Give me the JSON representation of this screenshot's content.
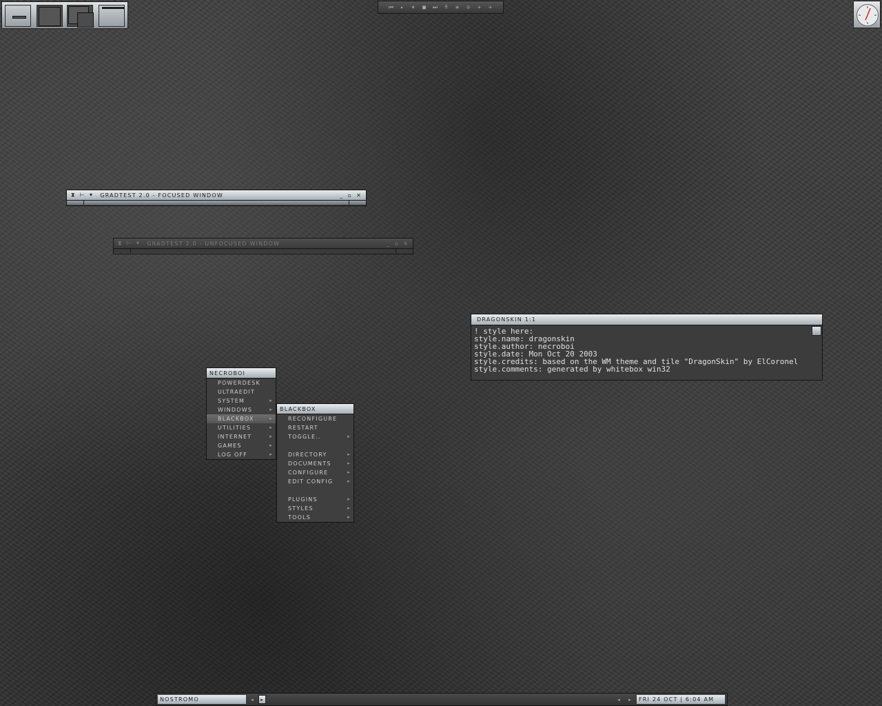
{
  "media_controls": [
    "⏮",
    "▸",
    "⏸",
    "■",
    "⏭",
    "≚",
    "≡",
    "⊙",
    "+",
    "+"
  ],
  "focused_window": {
    "buttons": [
      "⧗",
      "⊢",
      "▾"
    ],
    "title": "GRADTEST 2.0 - FOCUSED WINDOW",
    "controls": [
      "_",
      "▫",
      "✕"
    ]
  },
  "unfocused_window": {
    "buttons": [
      "⧗",
      "⊢",
      "▾"
    ],
    "title": "GRADTEST 2.0 - UNFOCUSED WINDOW",
    "controls": [
      "_",
      "▫",
      "✕"
    ]
  },
  "viewer": {
    "title": "DRAGONSKIN  1:1",
    "lines": [
      "! style here:",
      "style.name: dragonskin",
      "style.author: necroboi",
      "style.date: Mon Oct 20 2003",
      "style.credits: based on the WM theme and tile \"DragonSkin\" by ElCoronel",
      "style.comments: generated by whitebox win32"
    ]
  },
  "root_menu": {
    "title": "NECROBOI",
    "items": [
      {
        "label": "POWERDESK",
        "arrow": ""
      },
      {
        "label": "ULTRAEDIT",
        "arrow": ""
      },
      {
        "label": "SYSTEM",
        "arrow": "▸"
      },
      {
        "label": "WINDOWS",
        "arrow": "▸"
      },
      {
        "label": "BLACKBOX",
        "arrow": "▸"
      },
      {
        "label": "UTILITIES",
        "arrow": "▸"
      },
      {
        "label": "INTERNET",
        "arrow": "▸"
      },
      {
        "label": "GAMES",
        "arrow": "▸"
      },
      {
        "label": "LOG OFF",
        "arrow": "▸"
      }
    ],
    "selected": "BLACKBOX"
  },
  "blackbox_menu": {
    "title": "BLACKBOX",
    "items": [
      {
        "label": "RECONFIGURE",
        "arrow": ""
      },
      {
        "label": "RESTART",
        "arrow": ""
      },
      {
        "label": "TOGGLE..",
        "arrow": "▸"
      },
      {
        "label": "",
        "arrow": ""
      },
      {
        "label": "DIRECTORY",
        "arrow": "▸"
      },
      {
        "label": "DOCUMENTS",
        "arrow": "▸"
      },
      {
        "label": "CONFIGURE",
        "arrow": "▸"
      },
      {
        "label": "EDIT CONFIG",
        "arrow": "▸"
      },
      {
        "label": "",
        "arrow": ""
      },
      {
        "label": "PLUGINS",
        "arrow": "▸"
      },
      {
        "label": "STYLES",
        "arrow": "▸"
      },
      {
        "label": "TOOLS",
        "arrow": "▸"
      }
    ]
  },
  "toolbar": {
    "workspace_name": "NOSTROMO",
    "left_arrow": "◂",
    "right_arrow": "▸",
    "task_left": "◂",
    "task_right": "▸",
    "clock": "FRI 24 OCT | 6:04 AM"
  },
  "colors": {
    "accent": "#c8ced2",
    "clock_hand": "#cc2222"
  }
}
